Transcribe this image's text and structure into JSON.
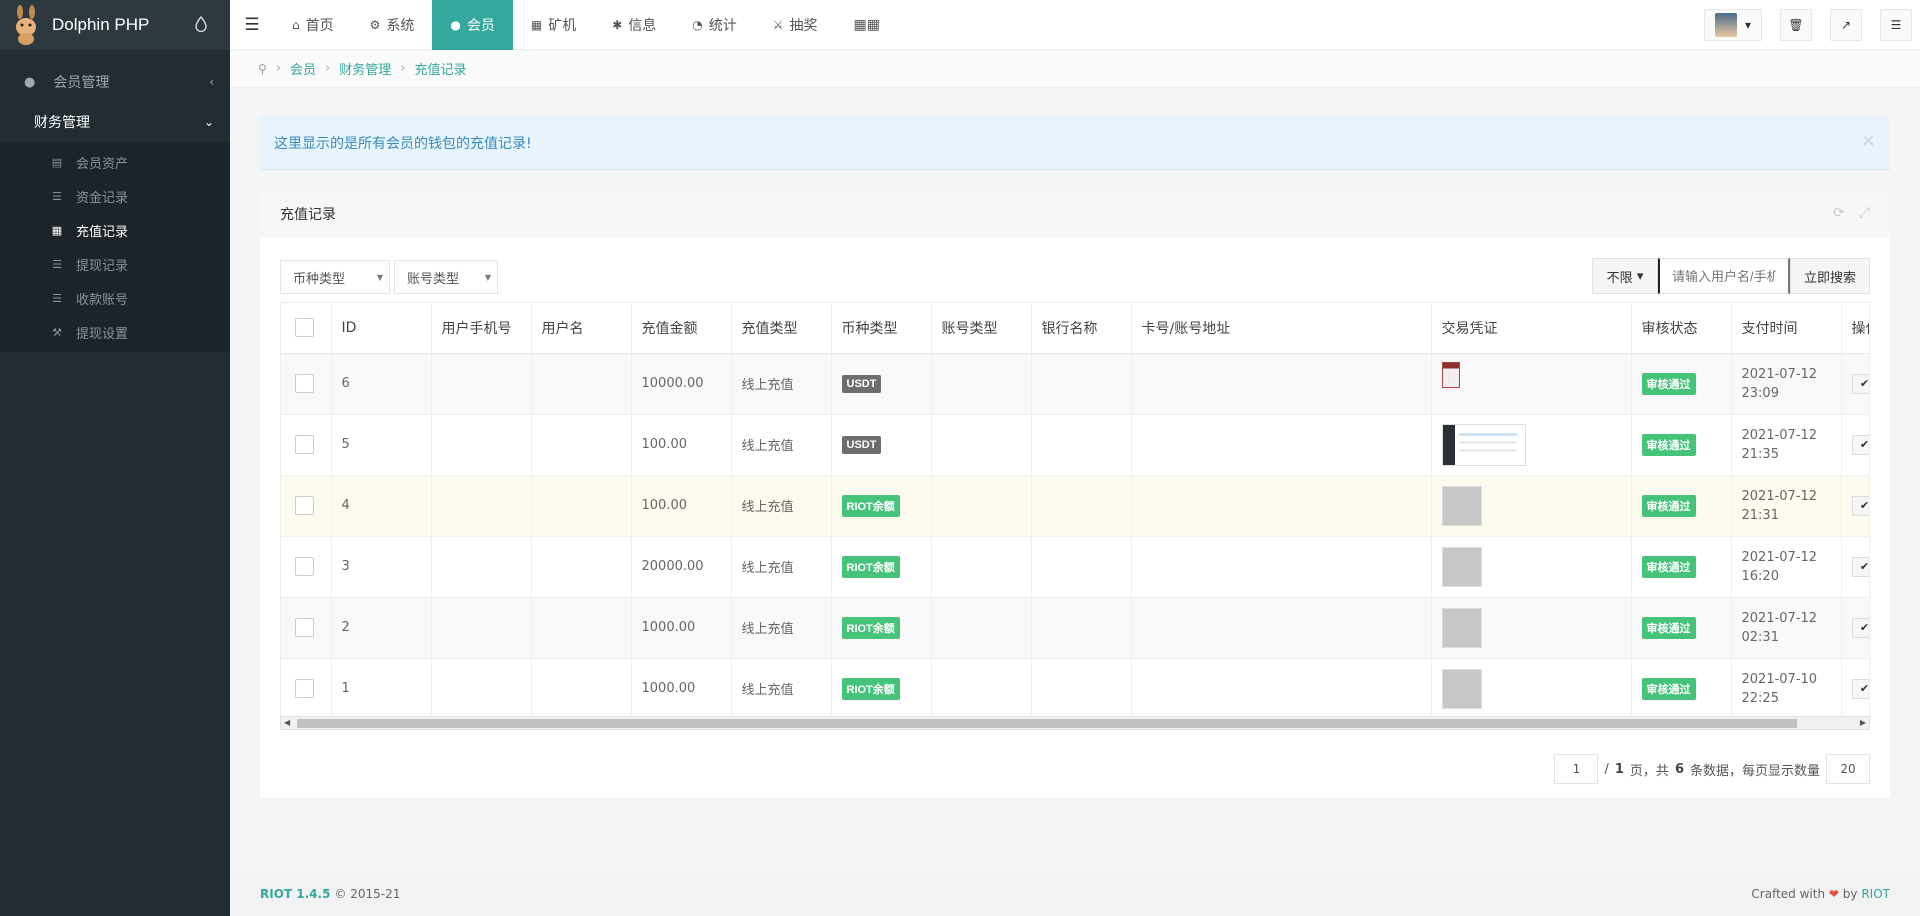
{
  "brand": "Dolphin PHP",
  "sidebar": {
    "groups": [
      {
        "label": "会员管理",
        "icon": "user-icon"
      },
      {
        "label": "财务管理",
        "icon": "none"
      }
    ],
    "items": [
      {
        "label": "会员资产",
        "icon": "bar-chart-icon"
      },
      {
        "label": "资金记录",
        "icon": "list-icon"
      },
      {
        "label": "充值记录",
        "icon": "credit-card-icon"
      },
      {
        "label": "提现记录",
        "icon": "list-icon"
      },
      {
        "label": "收款账号",
        "icon": "list-icon"
      },
      {
        "label": "提现设置",
        "icon": "wrench-icon"
      }
    ]
  },
  "topnav": {
    "items": [
      {
        "label": "首页",
        "icon": "home-icon"
      },
      {
        "label": "系统",
        "icon": "gear-icon"
      },
      {
        "label": "会员",
        "icon": "user-icon"
      },
      {
        "label": "矿机",
        "icon": "windows-icon"
      },
      {
        "label": "信息",
        "icon": "yelp-icon"
      },
      {
        "label": "统计",
        "icon": "pie-chart-icon"
      },
      {
        "label": "抽奖",
        "icon": "lottery-icon"
      }
    ]
  },
  "breadcrumb": [
    "会员",
    "财务管理",
    "充值记录"
  ],
  "alert": {
    "text": "这里显示的是所有会员的钱包的充值记录!",
    "close": "×"
  },
  "panel": {
    "title": "充值记录"
  },
  "filters": {
    "coin_type": "币种类型",
    "account_type": "账号类型"
  },
  "search": {
    "scope": "不限",
    "placeholder": "请输入用户名/手机号",
    "button": "立即搜索"
  },
  "table": {
    "headers": [
      "ID",
      "用户手机号",
      "用户名",
      "充值金额",
      "充值类型",
      "币种类型",
      "账号类型",
      "银行名称",
      "卡号/账号地址",
      "交易凭证",
      "审核状态",
      "支付时间",
      "操作"
    ],
    "rows": [
      {
        "id": "6",
        "phone": "",
        "username": "",
        "amount": "10000.00",
        "type": "线上充值",
        "coin": "USDT",
        "coin_color": "#6d6d6d",
        "account": "",
        "bank": "",
        "card": "",
        "proof": "red-receipt",
        "status": "审核通过",
        "time_date": "2021-07-12",
        "time_clock": "23:09"
      },
      {
        "id": "5",
        "phone": "",
        "username": "",
        "amount": "100.00",
        "type": "线上充值",
        "coin": "USDT",
        "coin_color": "#6d6d6d",
        "account": "",
        "bank": "",
        "card": "",
        "proof": "screenshot",
        "status": "审核通过",
        "time_date": "2021-07-12",
        "time_clock": "21:35"
      },
      {
        "id": "4",
        "phone": "",
        "username": "",
        "amount": "100.00",
        "type": "线上充值",
        "coin": "RIOT余额",
        "coin_color": "#46c37b",
        "account": "",
        "bank": "",
        "card": "",
        "proof": "placeholder",
        "status": "审核通过",
        "time_date": "2021-07-12",
        "time_clock": "21:31"
      },
      {
        "id": "3",
        "phone": "",
        "username": "",
        "amount": "20000.00",
        "type": "线上充值",
        "coin": "RIOT余额",
        "coin_color": "#46c37b",
        "account": "",
        "bank": "",
        "card": "",
        "proof": "placeholder",
        "status": "审核通过",
        "time_date": "2021-07-12",
        "time_clock": "16:20"
      },
      {
        "id": "2",
        "phone": "",
        "username": "",
        "amount": "1000.00",
        "type": "线上充值",
        "coin": "RIOT余额",
        "coin_color": "#46c37b",
        "account": "",
        "bank": "",
        "card": "",
        "proof": "placeholder",
        "status": "审核通过",
        "time_date": "2021-07-12",
        "time_clock": "02:31"
      },
      {
        "id": "1",
        "phone": "",
        "username": "",
        "amount": "1000.00",
        "type": "线上充值",
        "coin": "RIOT余额",
        "coin_color": "#46c37b",
        "account": "",
        "bank": "",
        "card": "",
        "proof": "placeholder",
        "status": "审核通过",
        "time_date": "2021-07-10",
        "time_clock": "22:25"
      }
    ]
  },
  "pager": {
    "current": "1",
    "total_pages": "1",
    "total_label": "页，共",
    "count": "6",
    "count_label": "条数据，每页显示数量",
    "per_page": "20"
  },
  "footer": {
    "version": "RIOT 1.4.5",
    "copyright": "© 2015-21",
    "crafted": "Crafted with",
    "by": "by",
    "author": "RIOT"
  },
  "colors": {
    "accent": "#34a89d",
    "sidebar": "#222c32",
    "success": "#46c37b",
    "usdt": "#6d6d6d"
  }
}
